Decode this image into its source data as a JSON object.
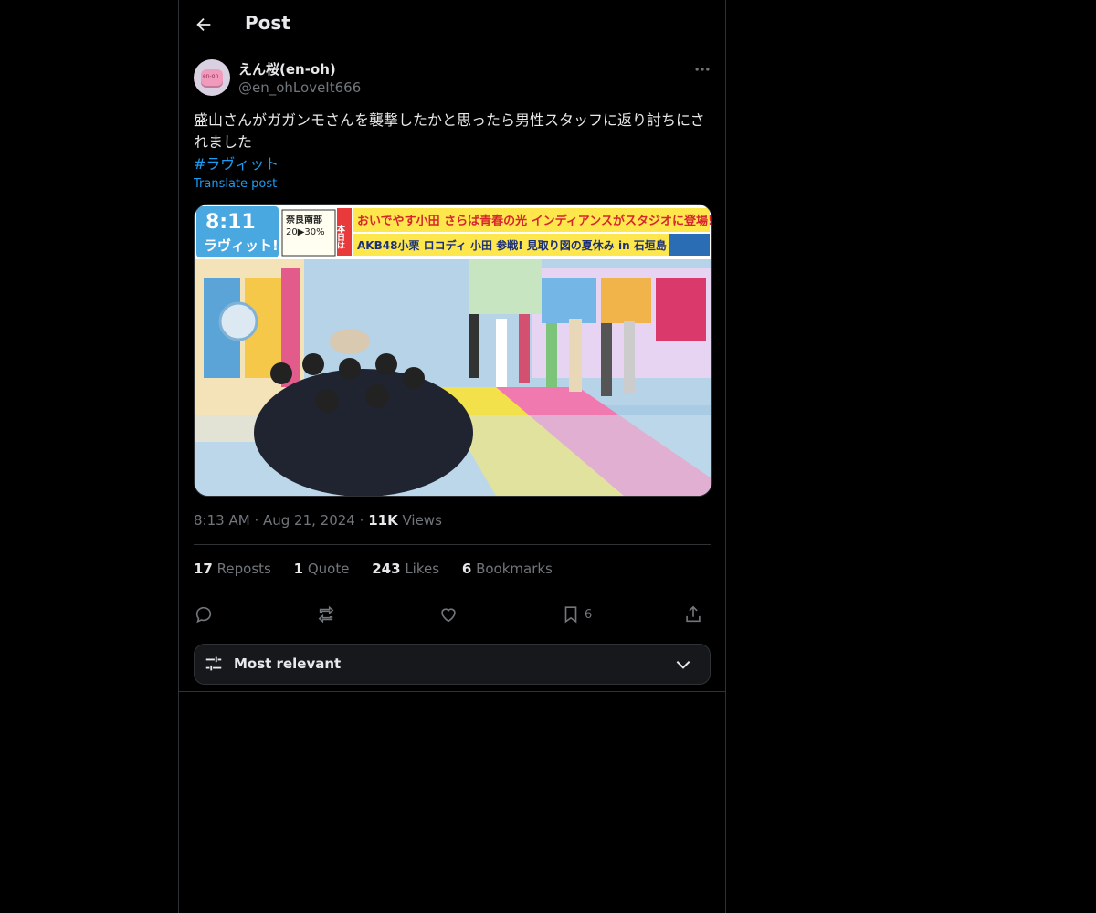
{
  "header": {
    "title": "Post"
  },
  "author": {
    "name": "えん桜(en-oh)",
    "handle": "@en_ohLoveIt666",
    "avatar_text": "en-oh"
  },
  "tweet": {
    "text": "盛山さんがガガンモさんを襲撃したかと思ったら男性スタッフに返り討ちにされました",
    "hashtag": "#ラヴィット",
    "translate": "Translate post"
  },
  "media": {
    "clock": "8:11",
    "logo": "ラヴィット!",
    "weather_region": "奈良南部",
    "weather_values": "20▶30%",
    "side_label": "本日は",
    "banner_top": "おいでやす小田 さらば青春の光 インディアンスがスタジオに登場!",
    "banner_bottom": "AKB48小栗 ロコディ 小田 参戦! 見取り図の夏休み in 石垣島"
  },
  "meta": {
    "time": "8:13 AM",
    "date": "Aug 21, 2024",
    "views_count": "11K",
    "views_label": "Views",
    "sep": "·"
  },
  "stats": {
    "reposts": {
      "count": "17",
      "label": "Reposts"
    },
    "quotes": {
      "count": "1",
      "label": "Quote"
    },
    "likes": {
      "count": "243",
      "label": "Likes"
    },
    "bookmarks": {
      "count": "6",
      "label": "Bookmarks"
    }
  },
  "actions": {
    "bookmark_count": "6"
  },
  "sort": {
    "label": "Most relevant"
  },
  "colors": {
    "accent": "#1d9bf0",
    "muted": "#71767b",
    "border": "#2f3336",
    "text": "#e7e9ea"
  },
  "icons": [
    "back-arrow-icon",
    "more-dots-icon",
    "reply-icon",
    "repost-icon",
    "like-icon",
    "bookmark-icon",
    "share-icon",
    "tune-icon",
    "chevron-down-icon"
  ]
}
